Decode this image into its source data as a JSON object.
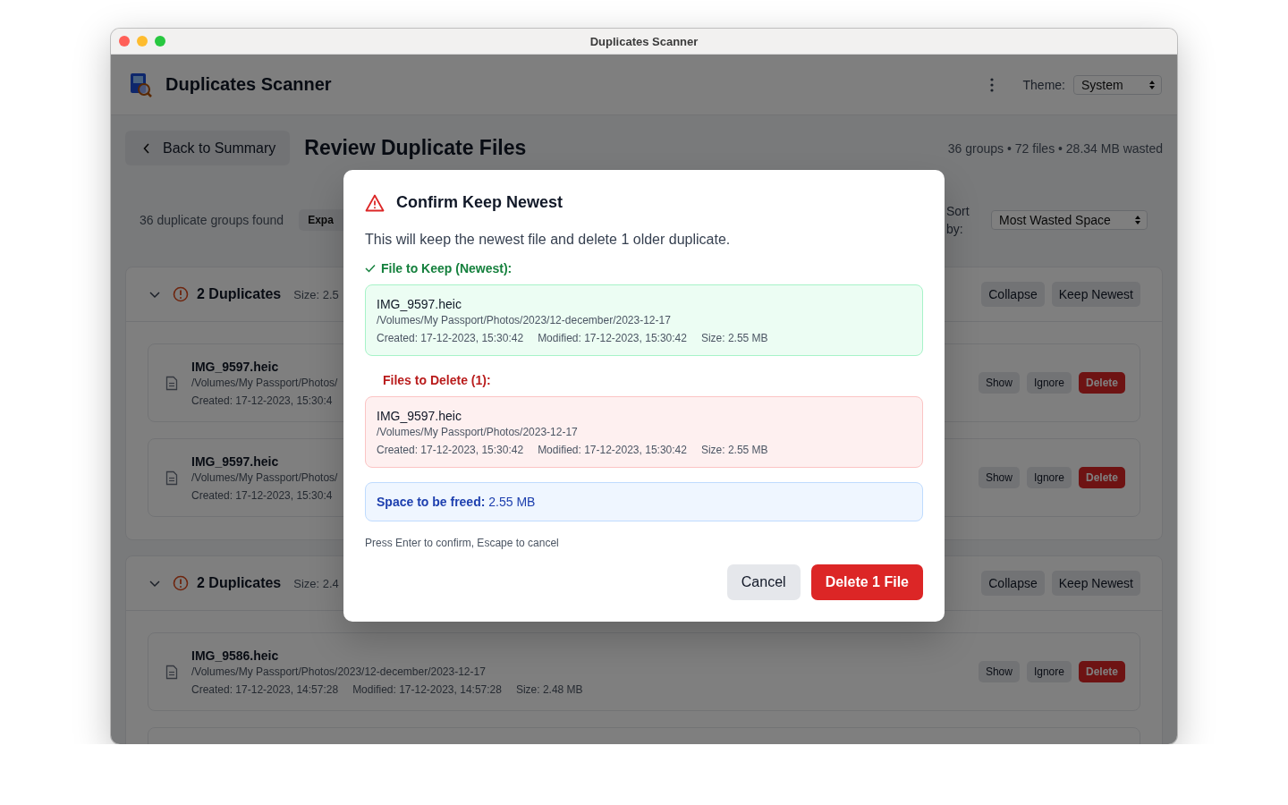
{
  "window": {
    "title": "Duplicates Scanner"
  },
  "header": {
    "app_name": "Duplicates Scanner",
    "theme_label": "Theme:",
    "theme_value": "System"
  },
  "page": {
    "back_button": "Back to Summary",
    "title": "Review Duplicate Files",
    "stats": "36 groups • 72 files • 28.34 MB wasted"
  },
  "toolbar": {
    "groups_found": "36 duplicate groups found",
    "expand_button": "Expa",
    "sort_label": "Sort by:",
    "sort_value": "Most Wasted Space"
  },
  "groups": [
    {
      "count": "2 Duplicates",
      "size": "Size: 2.5",
      "expanded": true,
      "buttons": [
        "Collapse",
        "Keep Newest"
      ],
      "files": [
        {
          "name": "IMG_9597.heic",
          "path": "/Volumes/My Passport/Photos/",
          "details": [
            "Created: 17-12-2023, 15:30:4"
          ],
          "actions": [
            {
              "label": "Show",
              "kind": "secondary"
            },
            {
              "label": "Ignore",
              "kind": "secondary"
            },
            {
              "label": "Delete",
              "kind": "danger"
            }
          ]
        },
        {
          "name": "IMG_9597.heic",
          "path": "/Volumes/My Passport/Photos/",
          "details": [
            "Created: 17-12-2023, 15:30:4"
          ],
          "actions": [
            {
              "label": "Show",
              "kind": "secondary"
            },
            {
              "label": "Ignore",
              "kind": "secondary"
            },
            {
              "label": "Delete",
              "kind": "danger"
            }
          ]
        }
      ]
    },
    {
      "count": "2 Duplicates",
      "size": "Size: 2.4",
      "expanded": true,
      "buttons": [
        "Collapse",
        "Keep Newest"
      ],
      "files": [
        {
          "name": "IMG_9586.heic",
          "path": "/Volumes/My Passport/Photos/2023/12-december/2023-12-17",
          "details": [
            "Created: 17-12-2023, 14:57:28",
            "Modified: 17-12-2023, 14:57:28",
            "Size: 2.48 MB"
          ],
          "actions": [
            {
              "label": "Show",
              "kind": "secondary"
            },
            {
              "label": "Ignore",
              "kind": "secondary"
            },
            {
              "label": "Delete",
              "kind": "danger"
            }
          ]
        }
      ]
    }
  ],
  "dialog": {
    "title": "Confirm Keep Newest",
    "message": "This will keep the newest file and delete 1 older duplicate.",
    "keep_heading": "File to Keep (Newest):",
    "keep_file": {
      "name": "IMG_9597.heic",
      "path": "/Volumes/My Passport/Photos/2023/12-december/2023-12-17",
      "details": [
        "Created: 17-12-2023, 15:30:42",
        "Modified: 17-12-2023, 15:30:42",
        "Size: 2.55 MB"
      ]
    },
    "delete_heading": "Files to Delete (1):",
    "delete_files": [
      {
        "name": "IMG_9597.heic",
        "path": "/Volumes/My Passport/Photos/2023-12-17",
        "details": [
          "Created: 17-12-2023, 15:30:42",
          "Modified: 17-12-2023, 15:30:42",
          "Size: 2.55 MB"
        ]
      }
    ],
    "space": "**Space to be freed:** 2.55 MB",
    "hint": "Press Enter to confirm, Escape to cancel",
    "buttons": [
      {
        "label": "Cancel",
        "kind": "secondary"
      },
      {
        "label": "Delete 1 File",
        "kind": "danger"
      }
    ]
  }
}
